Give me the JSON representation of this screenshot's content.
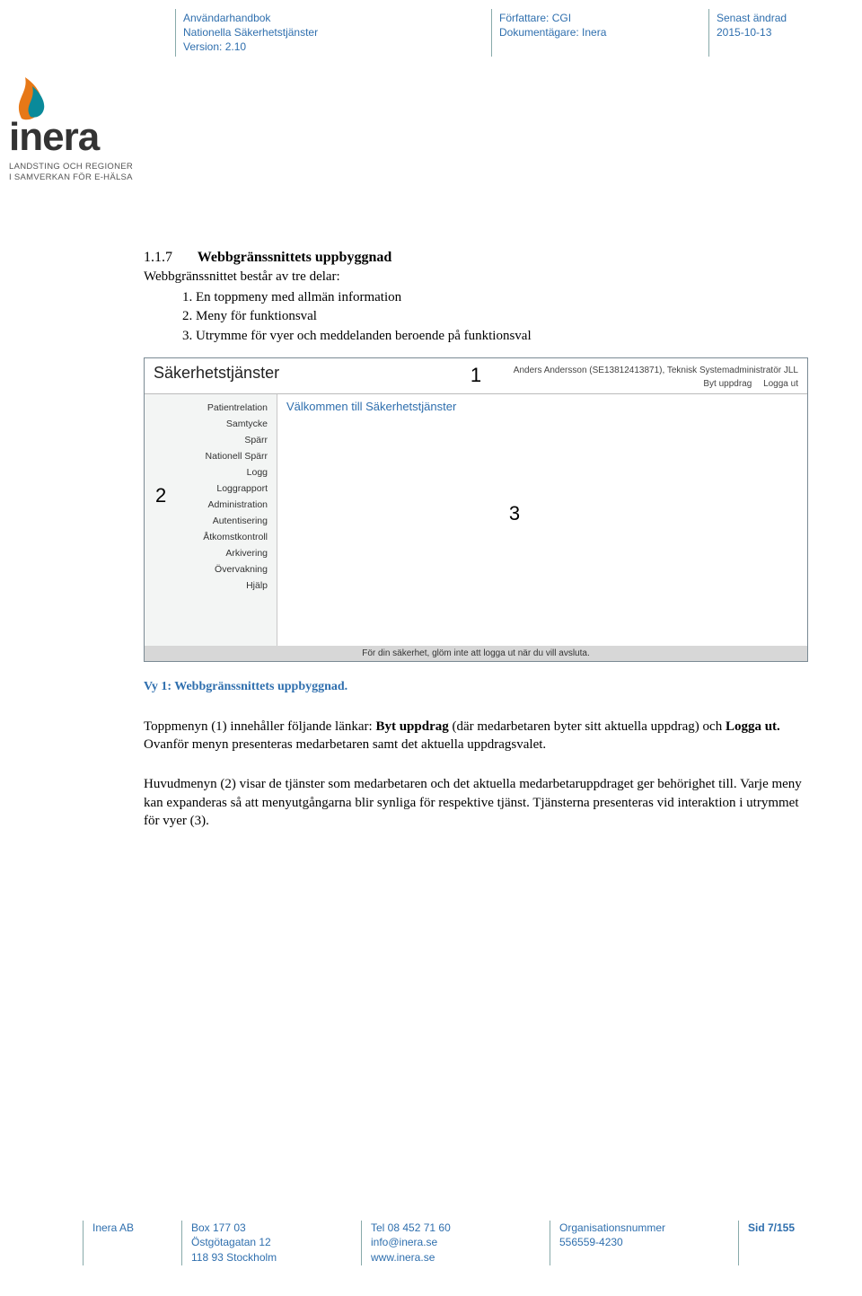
{
  "header": {
    "doc_title": "Användarhandbok",
    "doc_subtitle": "Nationella Säkerhetstjänster",
    "version_line": "Version: 2.10",
    "author_label": "Författare: CGI",
    "owner_label": "Dokumentägare: Inera",
    "changed_label": "Senast ändrad",
    "changed_date": "2015-10-13"
  },
  "logo": {
    "name": "inera",
    "tagline1": "LANDSTING OCH REGIONER",
    "tagline2": "I SAMVERKAN FÖR E-HÄLSA"
  },
  "section": {
    "number": "1.1.7",
    "title": "Webbgränssnittets uppbyggnad",
    "intro": "Webbgränssnittet består av tre delar:",
    "items": [
      "En toppmeny med allmän information",
      "Meny för funktionsval",
      "Utrymme för vyer och meddelanden beroende på funktionsval"
    ]
  },
  "figure": {
    "app_title": "Säkerhetstjänster",
    "user_line": "Anders Andersson (SE13812413871), Teknisk Systemadministratör JLL",
    "link_swap": "Byt uppdrag",
    "link_logout": "Logga ut",
    "welcome": "Välkommen till Säkerhetstjänster",
    "footer_text": "För din säkerhet, glöm inte att logga ut när du vill avsluta.",
    "side_items": [
      "Patientrelation",
      "Samtycke",
      "Spärr",
      "Nationell Spärr",
      "Logg",
      "Loggrapport",
      "Administration",
      "Autentisering",
      "Åtkomstkontroll",
      "Arkivering",
      "Övervakning",
      "Hjälp"
    ],
    "ann1": "1",
    "ann2": "2",
    "ann3": "3"
  },
  "caption": "Vy 1: Webbgränssnittets uppbyggnad.",
  "para1_a": "Toppmenyn (1) innehåller följande länkar: ",
  "para1_bold1": "Byt uppdrag",
  "para1_b": " (där medarbetaren byter sitt aktuella uppdrag) och ",
  "para1_bold2": "Logga ut.",
  "para1_c": " Ovanför menyn presenteras medarbetaren samt det aktuella uppdragsvalet.",
  "para2": "Huvudmenyn (2) visar de tjänster som medarbetaren och det aktuella medarbetaruppdraget ger behörighet till. Varje meny kan expanderas så att menyutgångarna blir synliga för respektive tjänst. Tjänsterna presenteras vid interaktion i utrymmet för vyer (3).",
  "footer": {
    "company": "Inera AB",
    "addr1": "Box 177 03",
    "addr2": "Östgötagatan 12",
    "addr3": "118 93 Stockholm",
    "tel": "Tel 08 452 71 60",
    "mail": "info@inera.se",
    "web": "www.inera.se",
    "orgnr_label": "Organisationsnummer",
    "orgnr": "556559-4230",
    "page": "Sid 7/155"
  }
}
